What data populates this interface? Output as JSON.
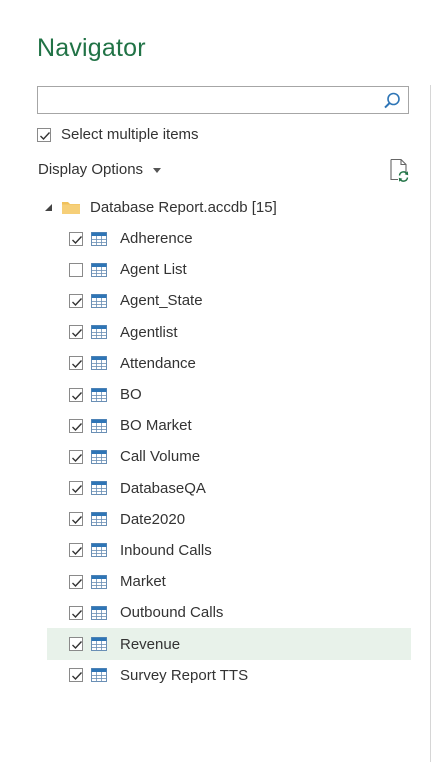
{
  "window": {
    "title": "Navigator"
  },
  "search": {
    "value": "",
    "placeholder": ""
  },
  "select_multiple": {
    "label": "Select multiple items",
    "checked": true
  },
  "display_options": {
    "label": "Display Options"
  },
  "tree": {
    "root": {
      "name": "Database Report.accdb [15]",
      "expanded": true
    },
    "items": [
      {
        "label": "Adherence",
        "checked": true,
        "selected": false
      },
      {
        "label": "Agent List",
        "checked": false,
        "selected": false
      },
      {
        "label": "Agent_State",
        "checked": true,
        "selected": false
      },
      {
        "label": "Agentlist",
        "checked": true,
        "selected": false
      },
      {
        "label": "Attendance",
        "checked": true,
        "selected": false
      },
      {
        "label": "BO",
        "checked": true,
        "selected": false
      },
      {
        "label": "BO Market",
        "checked": true,
        "selected": false
      },
      {
        "label": "Call Volume",
        "checked": true,
        "selected": false
      },
      {
        "label": "DatabaseQA",
        "checked": true,
        "selected": false
      },
      {
        "label": "Date2020",
        "checked": true,
        "selected": false
      },
      {
        "label": "Inbound Calls",
        "checked": true,
        "selected": false
      },
      {
        "label": "Market",
        "checked": true,
        "selected": false
      },
      {
        "label": "Outbound Calls",
        "checked": true,
        "selected": false
      },
      {
        "label": "Revenue",
        "checked": true,
        "selected": true
      },
      {
        "label": "Survey Report TTS",
        "checked": true,
        "selected": false
      }
    ]
  },
  "colors": {
    "accent": "#217346",
    "selected_row": "#e8f2ea",
    "table_icon": "#2e75b6"
  }
}
